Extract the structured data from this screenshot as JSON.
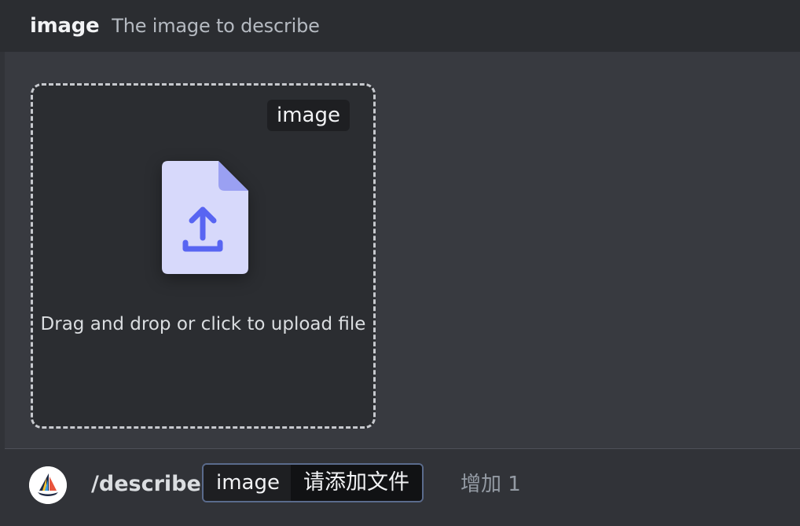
{
  "header": {
    "option_name": "image",
    "option_description": "The image to describe"
  },
  "dropzone": {
    "badge": "image",
    "icon": "file-upload-icon",
    "prompt": "Drag and drop or click to upload file"
  },
  "footer": {
    "avatar_icon": "midjourney-boat-logo",
    "command": "/describe",
    "option_name": "image",
    "option_value": "请添加文件",
    "extra": "增加 1"
  },
  "colors": {
    "background": "#313338",
    "header_bg": "#2b2d31",
    "panel_bg": "#383a40",
    "file_icon_body": "#d7d9fb",
    "file_icon_fold": "#9aa0f2",
    "upload_arrow": "#5865f2",
    "pill_border": "#5a6b8c"
  }
}
